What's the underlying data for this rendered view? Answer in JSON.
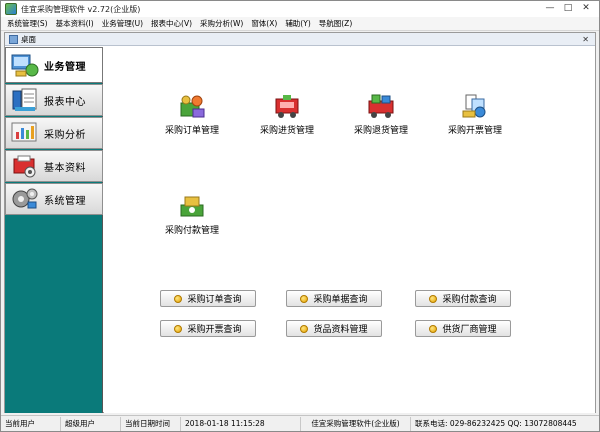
{
  "app": {
    "title": "佳宜采购管理软件 v2.72(企业版)"
  },
  "window_controls": [
    "—",
    "□",
    "✕"
  ],
  "menu": [
    "系统管理(S)",
    "基本资料(I)",
    "业务管理(U)",
    "报表中心(V)",
    "采购分析(W)",
    "窗体(X)",
    "辅助(Y)",
    "导航图(Z)"
  ],
  "child": {
    "title": "桌面",
    "close": "✕"
  },
  "sidebar": {
    "items": [
      {
        "label": "业务管理",
        "icon": "business-icon",
        "active": true
      },
      {
        "label": "报表中心",
        "icon": "report-icon",
        "active": false
      },
      {
        "label": "采购分析",
        "icon": "analysis-icon",
        "active": false
      },
      {
        "label": "基本资料",
        "icon": "basic-data-icon",
        "active": false
      },
      {
        "label": "系统管理",
        "icon": "system-icon",
        "active": false
      }
    ]
  },
  "features": [
    {
      "label": "采购订单管理",
      "icon": "purchase-order-icon"
    },
    {
      "label": "采购进货管理",
      "icon": "purchase-receive-icon"
    },
    {
      "label": "采购退货管理",
      "icon": "purchase-return-icon"
    },
    {
      "label": "采购开票管理",
      "icon": "purchase-invoice-icon"
    },
    {
      "label": "采购付款管理",
      "icon": "purchase-payment-icon"
    }
  ],
  "quick_buttons": [
    "采购订单查询",
    "采购单据查询",
    "采购付款查询",
    "采购开票查询",
    "货品资料管理",
    "供货厂商管理"
  ],
  "status": {
    "user_label": "当前用户",
    "user_value": "超级用户",
    "time_label": "当前日期时间",
    "time_value": "2018-01-18 11:15:28",
    "product": "佳宜采购管理软件(企业版)",
    "phone": "联系电话: 029-86232425  QQ: 13072808445"
  },
  "colors": {
    "sidebar_bg": "#0a7a7a",
    "button_bullet": "#e6a300"
  }
}
